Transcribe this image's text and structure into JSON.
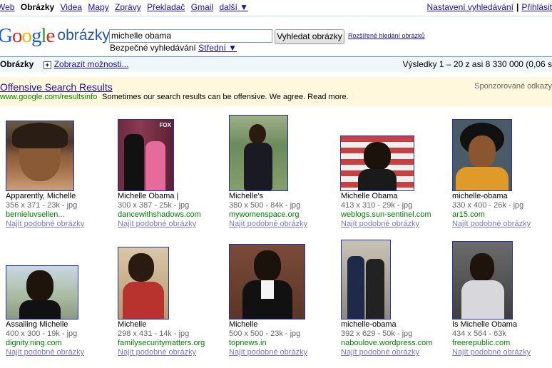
{
  "topnav": {
    "items": [
      "Web",
      "Obrázky",
      "Videa",
      "Mapy",
      "Zprávy",
      "Překladač",
      "Gmail"
    ],
    "more": "další ▼",
    "settings": "Nastavení vyhledávání",
    "signin": "Přihlásit"
  },
  "logo": {
    "main": "Google",
    "suffix": "obrázky"
  },
  "search": {
    "query": "michelle obama",
    "button": "Vyhledat obrázky",
    "advanced": "Rozšířené hledání obrázků",
    "safe_label": "Bezpečné vyhledávání",
    "safe_value": "Střední ▼"
  },
  "resultbar": {
    "section": "Obrázky",
    "options": "Zobrazit možnosti...",
    "summary": "Výsledky 1 – 20 z asi 8 330 000 (0,06 s"
  },
  "ad": {
    "title": "Offensive Search Results",
    "url": "www.google.com/resultsinfo",
    "desc": "Sometimes our search results can be offensive. We agree. Read more.",
    "sponsored": "Sponzorované odkazy"
  },
  "similar_label": "Najít podobné obrázky",
  "results": [
    {
      "title": "Apparently, Michelle",
      "meta": "356 x 371 - 23k - jpg",
      "domain": "bernieluvsellen..."
    },
    {
      "title": "Michelle Obama |",
      "meta": "300 x 387 - 25k - jpg",
      "domain": "dancewithshadows.com"
    },
    {
      "title": "Michelle's",
      "meta": "380 x 500 - 84k - jpg",
      "domain": "mywomenspace.org"
    },
    {
      "title": "Michelle Obama",
      "meta": "413 x 310 - 29k - jpg",
      "domain": "weblogs.sun-sentinel.com"
    },
    {
      "title": "michelle-obama",
      "meta": "330 x 400 - 26k - jpg",
      "domain": "ar15.com"
    },
    {
      "title": "Assailing Michelle",
      "meta": "400 x 300 - 19k - jpg",
      "domain": "dignity.ning.com"
    },
    {
      "title": "Michelle",
      "meta": "298 x 431 - 14k - jpg",
      "domain": "familysecuritymatters.org"
    },
    {
      "title": "Michelle",
      "meta": "500 x 500 - 23k - jpg",
      "domain": "topnews.in"
    },
    {
      "title": "michelle-obama",
      "meta": "392 x 629 - 50k - jpg",
      "domain": "naboulove.wordpress.com"
    },
    {
      "title": "Is Michelle Obama",
      "meta": "434 x 564 - 63k",
      "domain": "freerepublic.com"
    }
  ]
}
